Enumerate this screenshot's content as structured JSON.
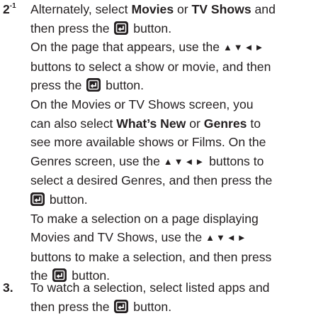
{
  "steps": [
    {
      "number": "2",
      "superscript": "-1",
      "paragraphs": [
        {
          "line1_pre": "Alternately, select ",
          "line1_b1": "Movies",
          "line1_mid": " or ",
          "line1_b2": "TV Shows",
          "line1_post": " and",
          "line2_pre": "then press the ",
          "line2_post": " button."
        },
        {
          "line1": "On the page that appears, use the",
          "line1_arrows": "▲▼◄►",
          "line2": "buttons to select a show or movie, and then",
          "line3_pre": "press the ",
          "line3_post": " button."
        },
        {
          "line1": "On the Movies or  TV Shows screen, you",
          "line2_pre": "can also select ",
          "line2_b1": "What’s New",
          "line2_mid": " or ",
          "line2_b2": "Genres",
          "line2_post": " to",
          "line3": "see more available shows or Films. On the",
          "line4_pre": "Genres screen, use the ",
          "line4_arrows": "▲▼◄►",
          "line4_post": " buttons to",
          "line5": "select a desired Genres, and then press the",
          "line6_post": " button."
        },
        {
          "line1": "To make a selection on a page displaying",
          "line2_pre": "Movies and TV Shows, use the ",
          "line2_arrows": "▲▼◄►",
          "line3": "buttons to make a selection, and then press",
          "line4_pre": "the ",
          "line4_post": " button."
        }
      ]
    },
    {
      "number": "3.",
      "line1": "To watch a selection, select listed apps and",
      "line2_pre": "then press the ",
      "line2_post": " button."
    }
  ],
  "icons": {
    "enter_button": "enter-button-icon"
  }
}
